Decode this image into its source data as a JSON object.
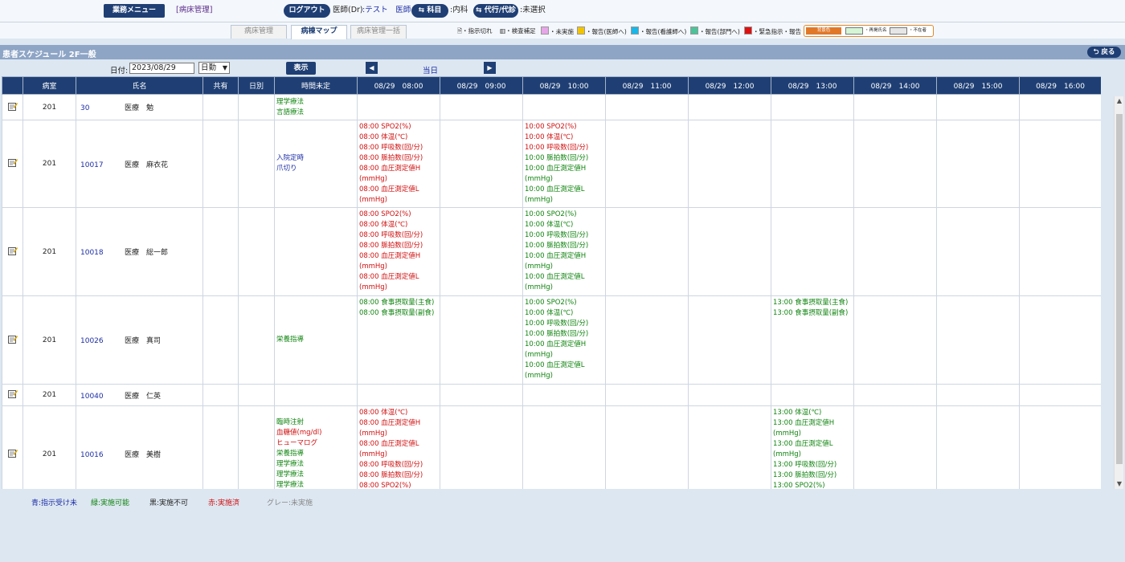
{
  "topbar": {
    "menu_label": "業務メニュー",
    "ward_link": "[病床管理]",
    "logout_label": "ログアウト",
    "user_role": "医師(Dr)",
    "user_name": ":テスト　医師",
    "dept_button": "科目",
    "dept_value": ":内科",
    "proxy_button": "代行/代診",
    "proxy_value": ":未選択"
  },
  "tabs": [
    {
      "label": "病床管理"
    },
    {
      "label": "病棟マップ"
    },
    {
      "label": "病床管理一括"
    }
  ],
  "legend": [
    {
      "label": "・指示切れ",
      "color": "#ffffff"
    },
    {
      "label": "・検査補足",
      "color": "#ffffff"
    },
    {
      "label": "・未実施",
      "color": "#e7a6e7"
    },
    {
      "label": "・報告(医師へ)",
      "color": "#f2c400"
    },
    {
      "label": "・報告(看護師へ)",
      "color": "#19b6e8"
    },
    {
      "label": "・報告(部門へ)",
      "color": "#4cc39a"
    },
    {
      "label": "・緊急指示・報告",
      "color": "#e01010"
    }
  ],
  "legend_box": {
    "item1": "背景色",
    "item2": "・再掲氏名",
    "item3": "・不在者"
  },
  "section": {
    "title": "患者スケジュール 2F一般",
    "back_label": "戻る"
  },
  "controls": {
    "date_label": "日付:",
    "date_value": "2023/08/29",
    "mode_value": "日勤",
    "show_button": "表示",
    "today_label": "当日"
  },
  "table": {
    "headers": [
      "病室",
      "氏名",
      "共有",
      "日別",
      "時間未定",
      "08/29　08:00",
      "08/29　09:00",
      "08/29　10:00",
      "08/29　11:00",
      "08/29　12:00",
      "08/29　13:00",
      "08/29　14:00",
      "08/29　15:00",
      "08/29　16:00"
    ],
    "rows": [
      {
        "room": "201",
        "pid": "30",
        "name": "医療　勉",
        "undetermined": [
          {
            "t": "理学療法",
            "c": "green"
          },
          {
            "t": "言語療法",
            "c": "green"
          }
        ],
        "slots": {}
      },
      {
        "room": "201",
        "pid": "10017",
        "name": "医療　麻衣花",
        "undetermined": [
          {
            "t": "入院定時",
            "c": "blue"
          },
          {
            "t": "爪切り",
            "c": "blue"
          }
        ],
        "slots": {
          "0": [
            {
              "t": "08:00 SPO2(%)",
              "c": "red"
            },
            {
              "t": "08:00 体温(℃)",
              "c": "red"
            },
            {
              "t": "08:00 呼吸数(回/分)",
              "c": "red"
            },
            {
              "t": "08:00 脈拍数(回/分)",
              "c": "red"
            },
            {
              "t": "08:00 血圧測定値H (mmHg)",
              "c": "red"
            },
            {
              "t": "08:00 血圧測定値L (mmHg)",
              "c": "red"
            }
          ],
          "2": [
            {
              "t": "10:00 SPO2(%)",
              "c": "red"
            },
            {
              "t": "10:00 体温(℃)",
              "c": "red"
            },
            {
              "t": "10:00 呼吸数(回/分)",
              "c": "red"
            },
            {
              "t": "10:00 脈拍数(回/分)",
              "c": "green"
            },
            {
              "t": "10:00 血圧測定値H (mmHg)",
              "c": "green"
            },
            {
              "t": "10:00 血圧測定値L (mmHg)",
              "c": "green"
            }
          ]
        }
      },
      {
        "room": "201",
        "pid": "10018",
        "name": "医療　総一郎",
        "undetermined": [],
        "slots": {
          "0": [
            {
              "t": "08:00 SPO2(%)",
              "c": "red"
            },
            {
              "t": "08:00 体温(℃)",
              "c": "red"
            },
            {
              "t": "08:00 呼吸数(回/分)",
              "c": "red"
            },
            {
              "t": "08:00 脈拍数(回/分)",
              "c": "red"
            },
            {
              "t": "08:00 血圧測定値H (mmHg)",
              "c": "red"
            },
            {
              "t": "08:00 血圧測定値L (mmHg)",
              "c": "red"
            }
          ],
          "2": [
            {
              "t": "10:00 SPO2(%)",
              "c": "green"
            },
            {
              "t": "10:00 体温(℃)",
              "c": "green"
            },
            {
              "t": "10:00 呼吸数(回/分)",
              "c": "green"
            },
            {
              "t": "10:00 脈拍数(回/分)",
              "c": "green"
            },
            {
              "t": "10:00 血圧測定値H (mmHg)",
              "c": "green"
            },
            {
              "t": "10:00 血圧測定値L (mmHg)",
              "c": "green"
            }
          ]
        }
      },
      {
        "room": "201",
        "pid": "10026",
        "name": "医療　真司",
        "undetermined": [
          {
            "t": "栄養指導",
            "c": "green"
          }
        ],
        "slots": {
          "0": [
            {
              "t": "08:00 食事摂取量(主食)",
              "c": "green"
            },
            {
              "t": "08:00 食事摂取量(副食)",
              "c": "green"
            }
          ],
          "2": [
            {
              "t": "10:00 SPO2(%)",
              "c": "green"
            },
            {
              "t": "10:00 体温(℃)",
              "c": "green"
            },
            {
              "t": "10:00 呼吸数(回/分)",
              "c": "green"
            },
            {
              "t": "10:00 脈拍数(回/分)",
              "c": "green"
            },
            {
              "t": "10:00 血圧測定値H (mmHg)",
              "c": "green"
            },
            {
              "t": "10:00 血圧測定値L (mmHg)",
              "c": "green"
            }
          ],
          "5": [
            {
              "t": "13:00 食事摂取量(主食)",
              "c": "green"
            },
            {
              "t": "13:00 食事摂取量(副食)",
              "c": "green"
            }
          ]
        }
      },
      {
        "room": "201",
        "pid": "10040",
        "name": "医療　仁英",
        "undetermined": [],
        "slots": {}
      },
      {
        "room": "201",
        "pid": "10016",
        "name": "医療　美樹",
        "undetermined": [
          {
            "t": "臨時注射",
            "c": "green"
          },
          {
            "t": "血糖値(mg/dl)",
            "c": "red"
          },
          {
            "t": "ヒューマログ",
            "c": "red"
          },
          {
            "t": "栄養指導",
            "c": "green"
          },
          {
            "t": "理学療法",
            "c": "green"
          },
          {
            "t": "理学療法",
            "c": "green"
          },
          {
            "t": "理学療法",
            "c": "green"
          }
        ],
        "slots": {
          "0": [
            {
              "t": "08:00 体温(℃)",
              "c": "red"
            },
            {
              "t": "08:00 血圧測定値H (mmHg)",
              "c": "red"
            },
            {
              "t": "08:00 血圧測定値L (mmHg)",
              "c": "red"
            },
            {
              "t": "08:00 呼吸数(回/分)",
              "c": "red"
            },
            {
              "t": "08:00 脈拍数(回/分)",
              "c": "red"
            },
            {
              "t": "08:00 SPO2(%)",
              "c": "red"
            }
          ],
          "5": [
            {
              "t": "13:00 体温(℃)",
              "c": "green"
            },
            {
              "t": "13:00 血圧測定値H (mmHg)",
              "c": "green"
            },
            {
              "t": "13:00 血圧測定値L (mmHg)",
              "c": "green"
            },
            {
              "t": "13:00 呼吸数(回/分)",
              "c": "green"
            },
            {
              "t": "13:00 脈拍数(回/分)",
              "c": "green"
            },
            {
              "t": "13:00 SPO2(%)",
              "c": "green"
            }
          ]
        }
      }
    ]
  },
  "status_legend": [
    {
      "label": "青:指示受け未",
      "color": "#1c2ea6"
    },
    {
      "label": "緑:実施可能",
      "color": "#108410"
    },
    {
      "label": "黒:実施不可",
      "color": "#222222"
    },
    {
      "label": "赤:実施済",
      "color": "#d01010"
    },
    {
      "label": "グレー:未実施",
      "color": "#888888"
    }
  ]
}
